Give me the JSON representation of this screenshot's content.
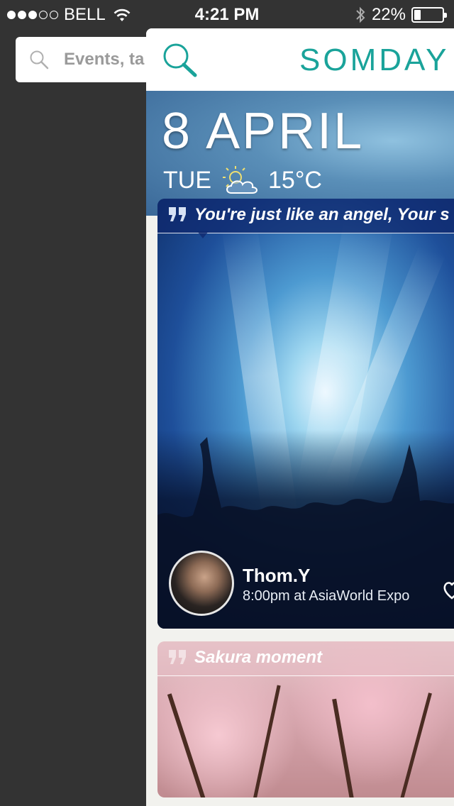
{
  "status_bar": {
    "carrier": "BELL",
    "time": "4:21 PM",
    "battery": "22%",
    "signal_bars": 3,
    "battery_level": 0.22
  },
  "side_search": {
    "placeholder": "Events, ta"
  },
  "header": {
    "brand": "SOMDAY"
  },
  "date": {
    "day_month": "8 APRIL",
    "weekday": "TUE",
    "temperature": "15°C"
  },
  "cards": [
    {
      "quote": "You're just like an angel, Your s",
      "name": "Thom.Y",
      "meta": "8:00pm at AsiaWorld Expo"
    },
    {
      "quote": "Sakura moment"
    }
  ],
  "colors": {
    "brand": "#1aa39a",
    "sidebar_bg": "#333333"
  }
}
